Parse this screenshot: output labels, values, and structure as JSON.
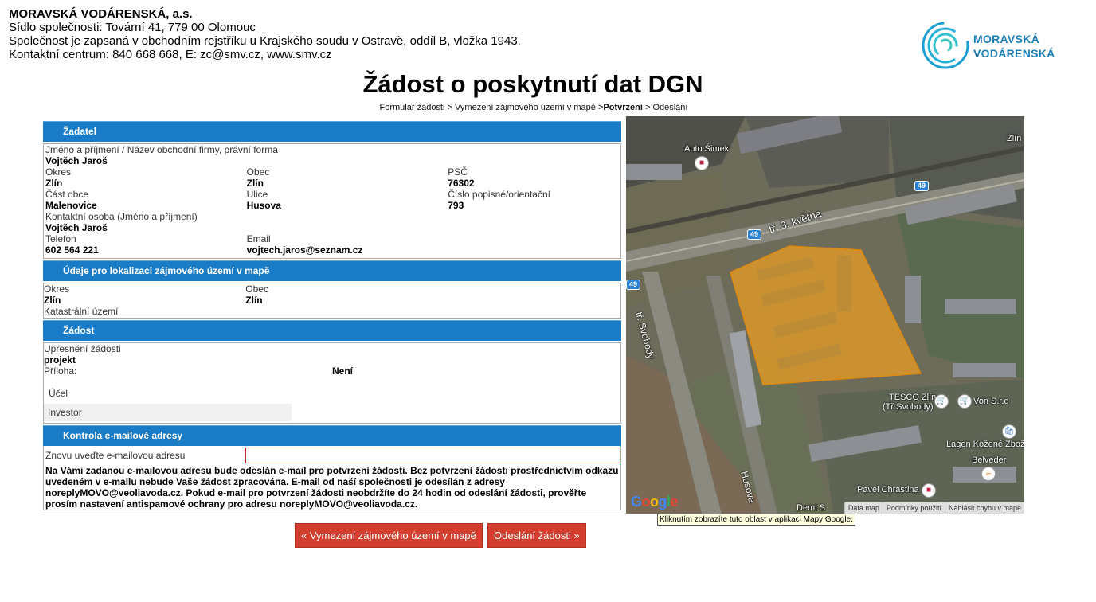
{
  "company": {
    "name": "MORAVSKÁ VODÁRENSKÁ, a.s.",
    "address": "Sídlo společnosti: Tovární 41, 779 00 Olomouc",
    "registration": "Společnost je zapsaná v obchodním rejstříku u Krajského soudu v Ostravě, oddíl B, vložka 1943.",
    "contact": "Kontaktní centrum: 840 668 668, E: zc@smv.cz, www.smv.cz",
    "logo_line1": "MORAVSKÁ",
    "logo_line2": "VODÁRENSKÁ",
    "brand_color": "#1a7fb4"
  },
  "page_title": "Žádost o poskytnutí dat DGN",
  "breadcrumb": {
    "step1": "Formulář žádosti",
    "sep1": " > ",
    "step2": "Vymezení zájmového území v mapě",
    "sep2": " >",
    "step3": "Potvrzení",
    "sep3": " > ",
    "step4": "Odeslání"
  },
  "applicant": {
    "heading": "Žadatel",
    "name_label": "Jméno a příjmení / Název obchodní firmy, právní forma",
    "name_value": "Vojtěch Jaroš",
    "okres_label": "Okres",
    "okres_value": "Zlín",
    "obec_label": "Obec",
    "obec_value": "Zlín",
    "psc_label": "PSČ",
    "psc_value": "76302",
    "cast_obce_label": "Část obce",
    "cast_obce_value": "Malenovice",
    "ulice_label": "Ulice",
    "ulice_value": "Husova",
    "cislo_label": "Číslo popisné/orientační",
    "cislo_value": "793",
    "kontakt_label": "Kontaktní osoba (Jméno a příjmení)",
    "kontakt_value": "Vojtěch Jaroš",
    "telefon_label": "Telefon",
    "telefon_value": "602 564 221",
    "email_label": "Email",
    "email_value": "vojtech.jaros@seznam.cz"
  },
  "location": {
    "heading": "Údaje pro lokalizaci zájmového území v mapě",
    "okres_label": "Okres",
    "okres_value": "Zlín",
    "obec_label": "Obec",
    "obec_value": "Zlín",
    "katastr_label": "Katastrální území"
  },
  "request": {
    "heading": "Žádost",
    "upresneni_label": "Upřesnění žádosti",
    "upresneni_value": "projekt",
    "priloha_label": "Příloha:",
    "priloha_value": "Není",
    "ucel_label": "Účel",
    "investor_label": "Investor"
  },
  "email_check": {
    "heading": "Kontrola e-mailové adresy",
    "repeat_label": "Znovu uveďte e-mailovou adresu",
    "repeat_value": "",
    "note": "Na Vámi zadanou e-mailovou adresu bude odeslán e-mail pro potvrzení žádosti. Bez potvrzení žádosti prostřednictvím odkazu uvedeném v e-mailu nebude Vaše žádost zpracována. E-mail od naší společnosti je odesílán z adresy noreplyMOVO@veoliavoda.cz. Pokud e-mail pro potvrzení žádosti neobdržíte do 24 hodin od odeslání žádosti, prověřte prosím nastavení antispamové ochrany pro adresu noreplyMOVO@veoliavoda.cz."
  },
  "buttons": {
    "back": "« Vymezení zájmového území v mapě",
    "send": "Odeslání žádosti »",
    "color": "#d23f2f"
  },
  "map": {
    "labels": {
      "auto_simek": "Auto Šimek",
      "zlin": "Zlín",
      "street_main": "tř. 3. května",
      "street_svobody": "tř. Svobody",
      "street_husova": "Husova",
      "tesco": "TESCO Zlín",
      "tesco_sub": "(Tř.Svobody)",
      "von": "Von S.r.o",
      "lagen": "Lagen Kožené Zboží",
      "belveder": "Belveder",
      "pavel": "Pavel Chrastina",
      "demi": "Demi S",
      "road49": "49"
    },
    "footer_data": "Data map",
    "footer_terms": "Podmínky použití",
    "footer_report": "Nahlásit chybu v mapě",
    "google": "Google",
    "tooltip": "Kliknutím zobrazíte tuto oblast v aplikaci Mapy Google.",
    "polygon_color": "#f0a020"
  }
}
